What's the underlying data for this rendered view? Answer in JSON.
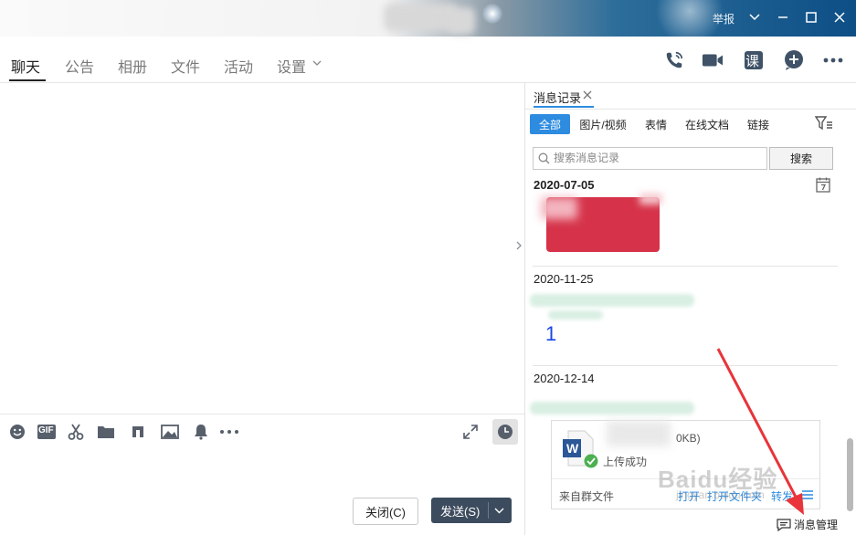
{
  "titlebar": {
    "report_label": "举报"
  },
  "tabs": [
    {
      "label": "聊天",
      "active": true
    },
    {
      "label": "公告"
    },
    {
      "label": "相册"
    },
    {
      "label": "文件"
    },
    {
      "label": "活动"
    },
    {
      "label": "设置"
    }
  ],
  "toolbar_icons": [
    "phone-icon",
    "video-icon",
    "course-icon",
    "add-app-icon",
    "more-icon"
  ],
  "course_glyph": "课",
  "input_toolbar_icons": [
    "emoji-icon",
    "gif-icon",
    "scissors-icon",
    "folder-icon",
    "music-icon",
    "image-icon",
    "bell-icon",
    "more-icon",
    "expand-icon",
    "history-clock-icon"
  ],
  "gif_label": "GIF",
  "buttons": {
    "close": "关闭(C)",
    "send": "发送(S)"
  },
  "history": {
    "title": "消息记录",
    "filters": [
      "全部",
      "图片/视频",
      "表情",
      "在线文档",
      "链接"
    ],
    "search_placeholder": "搜索消息记录",
    "search_button": "搜索",
    "groups": [
      {
        "date": "2020-07-05"
      },
      {
        "date": "2020-11-25",
        "message": "1"
      },
      {
        "date": "2020-12-14"
      }
    ],
    "file": {
      "size_fragment": "0KB)",
      "status": "上传成功",
      "source": "来自群文件",
      "actions": [
        "打开",
        "打开文件夹",
        "转发"
      ]
    },
    "manage_label": "消息管理"
  },
  "colors": {
    "accent": "#2d8be0",
    "send_button": "#3c4b5d",
    "annotation_arrow": "#e8343a"
  },
  "watermark": {
    "main": "Baidu经验",
    "sub": "jingyan.baidu.com"
  }
}
